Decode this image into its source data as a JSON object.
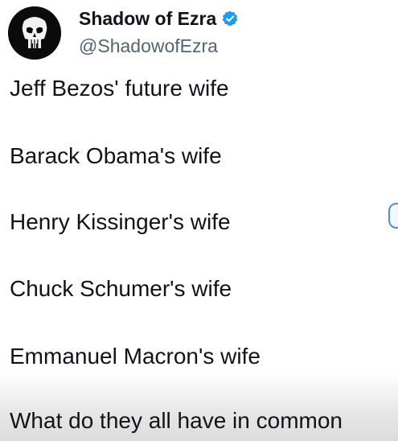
{
  "author": {
    "display_name": "Shadow of Ezra",
    "handle": "@ShadowofEzra",
    "verified": true,
    "verified_color": "#1d9bf0",
    "avatar_icon": "punisher-skull-icon"
  },
  "tweet": {
    "lines": [
      "Jeff Bezos' future wife",
      "Barack Obama's wife",
      "Henry Kissinger's wife",
      "Chuck Schumer's wife",
      "Emmanuel Macron's wife"
    ],
    "last_line": "What do they all have in common"
  },
  "colors": {
    "text": "#0f1419",
    "secondary_text": "#536471",
    "accent": "#1d9bf0"
  }
}
